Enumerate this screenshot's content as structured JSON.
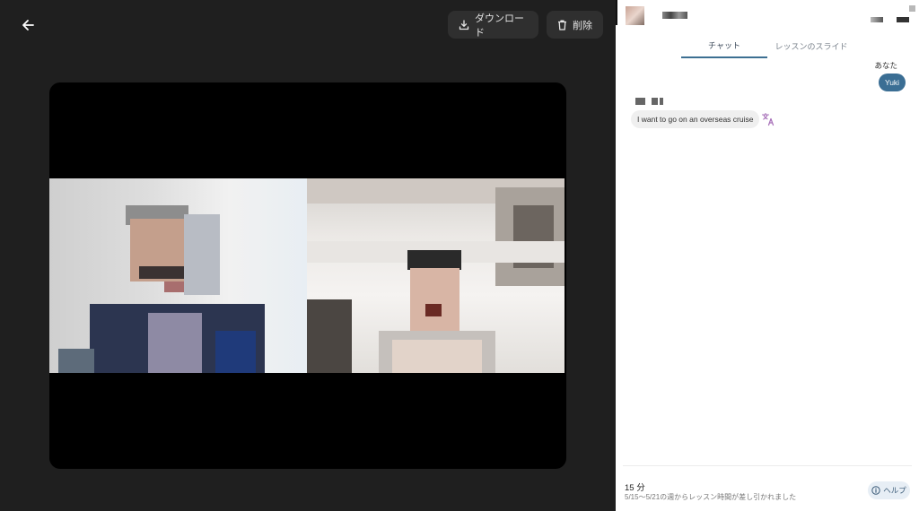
{
  "toolbar": {
    "back_icon": "arrow-left-icon",
    "download_label": "ダウンロード",
    "download_icon": "download-icon",
    "delete_label": "削除",
    "delete_icon": "trash-icon"
  },
  "chat_panel": {
    "tabs": [
      {
        "label": "チャット",
        "active": true
      },
      {
        "label": "レッスンのスライド",
        "active": false
      }
    ],
    "messages": [
      {
        "sender_label": "あなた",
        "text": "Yuki",
        "mine": true
      },
      {
        "text": "I want to go on an overseas cruise",
        "mine": false,
        "translate_icon": "translate-icon"
      }
    ]
  },
  "footer": {
    "duration": "15 分",
    "note": "5/15〜5/21の週からレッスン時間が差し引かれました",
    "help_label": "ヘルプ",
    "help_icon": "info-icon"
  },
  "colors": {
    "viewer_bg": "#1f1f1f",
    "accent": "#3b6e94",
    "button_bg": "#2f2f2f"
  }
}
